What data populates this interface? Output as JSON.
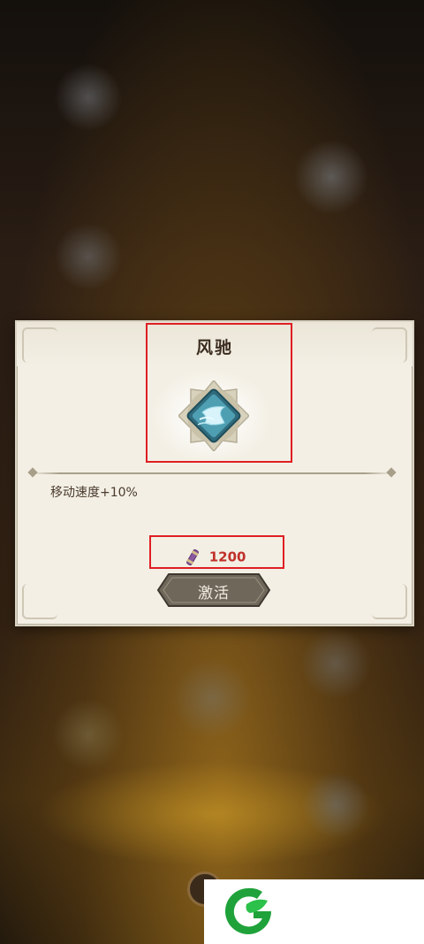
{
  "dialog": {
    "title": "风驰",
    "skill_icon": "wind-boot-skill-icon",
    "description": "移动速度+10%",
    "cost": {
      "icon": "scroll-currency-icon",
      "amount": "1200"
    },
    "activate_button": "激活"
  },
  "watermark": {
    "icon": "green-g-leaf-logo"
  },
  "colors": {
    "panel_bg": "#f3efe4",
    "title": "#3b2d1f",
    "cost_text": "#c0302a",
    "annotation_box": "#e01e24",
    "button_bg": "#6f675a"
  }
}
